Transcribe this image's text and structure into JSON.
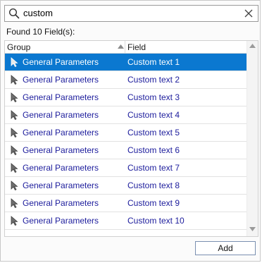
{
  "search": {
    "query": "custom"
  },
  "results_label": "Found 10 Field(s):",
  "columns": {
    "group": "Group",
    "field": "Field"
  },
  "rows": [
    {
      "group": "General Parameters",
      "field": "Custom text  1"
    },
    {
      "group": "General Parameters",
      "field": "Custom text  2"
    },
    {
      "group": "General Parameters",
      "field": "Custom text  3"
    },
    {
      "group": "General Parameters",
      "field": "Custom text  4"
    },
    {
      "group": "General Parameters",
      "field": "Custom text  5"
    },
    {
      "group": "General Parameters",
      "field": "Custom text  6"
    },
    {
      "group": "General Parameters",
      "field": "Custom text  7"
    },
    {
      "group": "General Parameters",
      "field": "Custom text  8"
    },
    {
      "group": "General Parameters",
      "field": "Custom text  9"
    },
    {
      "group": "General Parameters",
      "field": "Custom text 10"
    }
  ],
  "selected_row": 0,
  "add_button": "Add",
  "icons": {
    "search": "search-icon",
    "clear": "close-icon",
    "row": "pointer-arrow-icon"
  },
  "colors": {
    "selection": "#0b78d0",
    "row_text": "#1c1c9c"
  }
}
